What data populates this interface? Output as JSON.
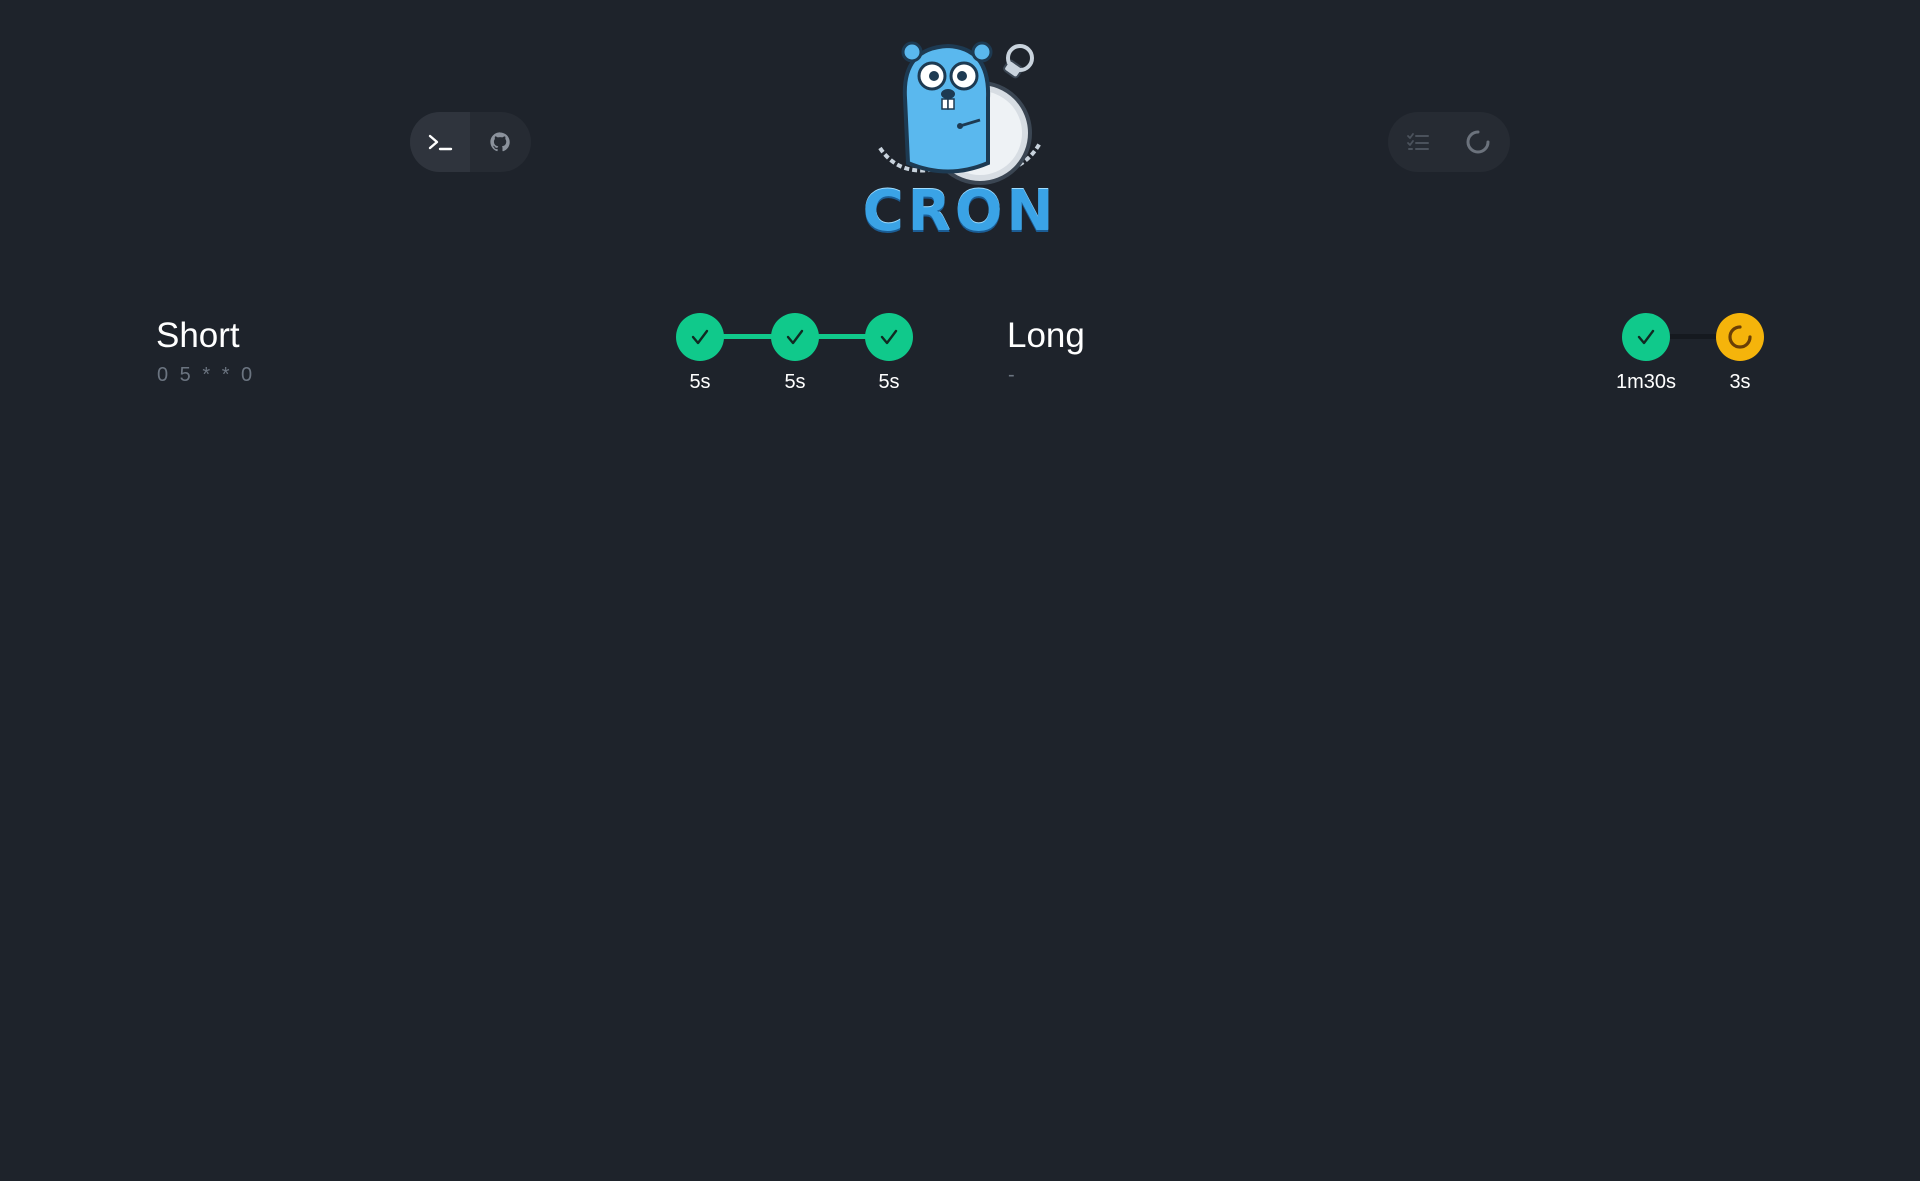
{
  "header": {
    "left_buttons": [
      {
        "icon": "terminal-icon",
        "active": true
      },
      {
        "icon": "github-icon",
        "active": false
      }
    ],
    "right_buttons": [
      {
        "icon": "task-list-icon"
      },
      {
        "icon": "spinner-icon"
      }
    ],
    "logo": {
      "text": "CRON",
      "mascot": "gopher-with-stopwatch"
    }
  },
  "jobs": [
    {
      "name": "Short",
      "schedule": "0 5 * * 0",
      "runs": [
        {
          "status": "success",
          "duration": "5s"
        },
        {
          "status": "success",
          "duration": "5s"
        },
        {
          "status": "success",
          "duration": "5s"
        }
      ]
    },
    {
      "name": "Long",
      "schedule": "-",
      "runs": [
        {
          "status": "success",
          "duration": "1m30s"
        },
        {
          "status": "running",
          "duration": "3s"
        }
      ]
    }
  ],
  "colors": {
    "background": "#1e232b",
    "success": "#10c98b",
    "running": "#f5b40b",
    "muted": "#6b7480"
  }
}
